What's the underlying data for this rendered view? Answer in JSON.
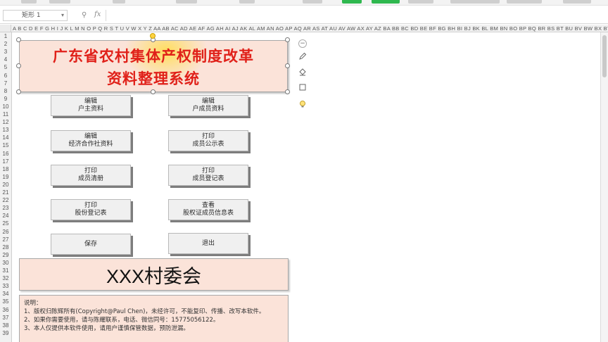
{
  "formula_bar": {
    "name_box": "矩形 1",
    "fx": "fx"
  },
  "columns": "A B C D E F G H I J K L M N O P Q R S T U V W X Y Z AA AB AC AD AE AF AG AH AI AJ AK AL AM AN AO AP AQ AR AS AT AU AV AW AX AY AZ BA BB BC BD BE BF BG BH BI BJ BK BL BM BN BO BP BQ BR BS BT BU BV BW BX BY BZ CA CB CC CD CE CF CG CH CI CJ CK CL CM CN CO CP CQ CR CS CT CU CV CW CX CY CZ",
  "rows": [
    "1",
    "2",
    "3",
    "4",
    "5",
    "6",
    "7",
    "8",
    "9",
    "10",
    "11",
    "12",
    "13",
    "14",
    "15",
    "16",
    "17",
    "18",
    "19",
    "20",
    "21",
    "22",
    "23",
    "24",
    "25",
    "26",
    "27",
    "28",
    "29",
    "30",
    "31",
    "32",
    "33",
    "34",
    "35",
    "36",
    "37",
    "38",
    "39"
  ],
  "title": {
    "line1": "广东省农村集体产权制度改革",
    "line2": "资料整理系统"
  },
  "buttons": [
    {
      "id": "edit-household",
      "line1": "编辑",
      "line2": "户主资料"
    },
    {
      "id": "edit-members",
      "line1": "编辑",
      "line2": "户成员资料"
    },
    {
      "id": "edit-coop",
      "line1": "编辑",
      "line2": "经济合作社资料"
    },
    {
      "id": "print-public",
      "line1": "打印",
      "line2": "成员公示表"
    },
    {
      "id": "print-roster",
      "line1": "打印",
      "line2": "成员清册"
    },
    {
      "id": "print-register",
      "line1": "打印",
      "line2": "成员登记表"
    },
    {
      "id": "print-shares",
      "line1": "打印",
      "line2": "股份登记表"
    },
    {
      "id": "view-cert",
      "line1": "查看",
      "line2": "股权证成员信息表"
    },
    {
      "id": "save",
      "line1": "保存",
      "line2": ""
    },
    {
      "id": "exit",
      "line1": "退出",
      "line2": ""
    }
  ],
  "village": "XXX村委会",
  "notes": {
    "heading": "说明：",
    "line1": "1、版权归陈辉所有(Copyright@Paul Chen)，未经许可，不能复印、传播、改写本软件。",
    "line2": "2、如果你需要使用，请与陈耀联系，电话、微信同号：15775056122。",
    "line3": "3、本人仅提供本软件使用，请用户谨慎保管数据，预防泄漏。"
  },
  "icons": {
    "collapse": "minus-circle-icon",
    "pen": "pen-icon",
    "fill": "fill-bucket-icon",
    "border": "shape-outline-icon",
    "idea": "lightbulb-icon"
  },
  "colors": {
    "title_text": "#e02019",
    "panel_fill": "#fbe3d9",
    "button_face": "#f0f0f0",
    "button_shadow": "#7d7d7d"
  }
}
